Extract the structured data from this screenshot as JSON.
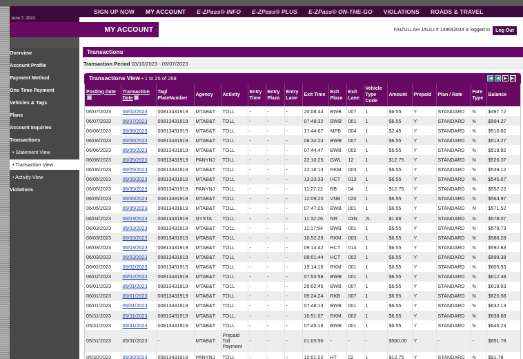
{
  "nav": {
    "items": [
      {
        "label": "SIGN UP NOW",
        "italic": false,
        "active": false
      },
      {
        "label": "MY ACCOUNT",
        "italic": false,
        "active": true
      },
      {
        "label": "E-ZPass® INFO",
        "italic": true,
        "active": false
      },
      {
        "label": "E-ZPass® PLUS",
        "italic": true,
        "active": false
      },
      {
        "label": "E-ZPass® ON-THE-GO",
        "italic": true,
        "active": false
      },
      {
        "label": "VIOLATIONS",
        "italic": false,
        "active": false
      },
      {
        "label": "ROADS & TRAVEL",
        "italic": false,
        "active": false
      }
    ]
  },
  "header": {
    "date": "June 7, 2023",
    "title": "MY ACCOUNT",
    "user_line": "FAIZULLAH JALILI # 148643034 is logged in",
    "logout_label": "Log Out"
  },
  "sidebar": {
    "items": [
      {
        "label": "Overview",
        "sub": false,
        "active": false
      },
      {
        "label": "Account Profile",
        "sub": false,
        "active": false
      },
      {
        "label": "Payment Method",
        "sub": false,
        "active": false
      },
      {
        "label": "One Time Payment",
        "sub": false,
        "active": false
      },
      {
        "label": "Vehicles & Tags",
        "sub": false,
        "active": false
      },
      {
        "label": "Plans",
        "sub": false,
        "active": false
      },
      {
        "label": "Account Inquiries",
        "sub": false,
        "active": false
      },
      {
        "label": "Transactions",
        "sub": false,
        "active": false
      },
      {
        "label": "• Statement View",
        "sub": true,
        "active": false
      },
      {
        "label": "• Transaction View",
        "sub": true,
        "active": true
      },
      {
        "label": "• Activity View",
        "sub": true,
        "active": false
      },
      {
        "label": "Violations",
        "sub": false,
        "active": false
      }
    ]
  },
  "section": {
    "title": "Transactions",
    "period_label": "Transaction Period",
    "period_value": "03/10/2023 - 06/07/2023"
  },
  "view": {
    "title": "Transactions View",
    "count": " • 1 to 25 of 268",
    "pager": [
      "|◀",
      "◀",
      "▶",
      "▶|"
    ]
  },
  "table": {
    "columns": [
      "Posting Date",
      "Transaction Date",
      "Tag/ PlateNumber",
      "Agency",
      "Activity",
      "Entry Time",
      "Entry Plaza",
      "Entry Lane",
      "Exit Time",
      "Exit Plaza",
      "Exit Lane",
      "Vehicle Type Code",
      "Amount",
      "Prepaid",
      "Plan / Rate",
      "Fare Type",
      "Balance"
    ],
    "rows": [
      [
        "06/07/2023",
        "06/02/2023",
        "00813431919",
        "MTAB&T",
        "TOLL",
        "-",
        "-",
        "-",
        "20:08:44",
        "BWB",
        "007",
        "1",
        "$6.55",
        "Y",
        "STANDARD",
        "N",
        "$497.72"
      ],
      [
        "06/07/2023",
        "06/07/2023",
        "00813431919",
        "MTAB&T",
        "TOLL",
        "-",
        "-",
        "-",
        "07:48:32",
        "BWB",
        "001",
        "1",
        "$6.55",
        "Y",
        "STANDARD",
        "N",
        "$504.27"
      ],
      [
        "06/06/2023",
        "06/06/2023",
        "00813431919",
        "MTAB&T",
        "TOLL",
        "-",
        "-",
        "-",
        "17:44:07",
        "MPB",
        "004",
        "1",
        "$2.45",
        "Y",
        "STANDARD",
        "N",
        "$510.82"
      ],
      [
        "06/06/2023",
        "06/06/2023",
        "00813431919",
        "MTAB&T",
        "TOLL",
        "-",
        "-",
        "-",
        "08:34:24",
        "BWB",
        "007",
        "1",
        "$6.55",
        "Y",
        "STANDARD",
        "N",
        "$513.27"
      ],
      [
        "06/06/2023",
        "06/06/2023",
        "00813431919",
        "MTAB&T",
        "TOLL",
        "-",
        "-",
        "-",
        "07:44:47",
        "BWB",
        "002",
        "1",
        "$6.55",
        "Y",
        "STANDARD",
        "N",
        "$519.82"
      ],
      [
        "06/06/2023",
        "06/05/2023",
        "00813431919",
        "PANYNJ",
        "TOLL",
        "-",
        "-",
        "-",
        "22:10:25",
        "GWL",
        "12",
        "1",
        "$12.75",
        "Y",
        "STANDARD",
        "N",
        "$526.37"
      ],
      [
        "06/06/2023",
        "06/05/2023",
        "00813431919",
        "MTAB&T",
        "TOLL",
        "-",
        "-",
        "-",
        "22:18:14",
        "RKM",
        "003",
        "1",
        "$6.55",
        "Y",
        "STANDARD",
        "N",
        "$539.12"
      ],
      [
        "06/05/2023",
        "06/05/2023",
        "00813431919",
        "MTAB&T",
        "TOLL",
        "-",
        "-",
        "-",
        "13:33:33",
        "HCT",
        "013",
        "1",
        "$6.55",
        "Y",
        "STANDARD",
        "N",
        "$545.67"
      ],
      [
        "06/05/2023",
        "06/05/2023",
        "00813431919",
        "PANYNJ",
        "TOLL",
        "-",
        "-",
        "-",
        "11:27:22",
        "BB",
        "04",
        "1",
        "$12.75",
        "Y",
        "STANDARD",
        "N",
        "$552.22"
      ],
      [
        "06/05/2023",
        "06/05/2023",
        "00813431919",
        "MTAB&T",
        "TOLL",
        "-",
        "-",
        "-",
        "12:09:20",
        "VNB",
        "020",
        "1",
        "$6.55",
        "Y",
        "STANDARD",
        "N",
        "$564.97"
      ],
      [
        "06/05/2023",
        "06/05/2023",
        "00813431919",
        "MTAB&T",
        "TOLL",
        "-",
        "-",
        "-",
        "07:47:25",
        "BWB",
        "001",
        "1",
        "$6.55",
        "Y",
        "STANDARD",
        "N",
        "$571.52"
      ],
      [
        "06/04/2023",
        "06/03/2023",
        "00813431919",
        "NYSTA",
        "TOLL",
        "-",
        "-",
        "-",
        "11:32:26",
        "NR",
        "03N",
        "2L",
        "$1.66",
        "Y",
        "STANDARD",
        "N",
        "$578.07"
      ],
      [
        "06/03/2023",
        "06/03/2023",
        "00813431919",
        "MTAB&T",
        "TOLL",
        "-",
        "-",
        "-",
        "11:17:54",
        "BWB",
        "001",
        "1",
        "$6.55",
        "Y",
        "STANDARD",
        "N",
        "$579.73"
      ],
      [
        "06/03/2023",
        "06/03/2023",
        "00813431919",
        "MTAB&T",
        "TOLL",
        "-",
        "-",
        "-",
        "10:52:29",
        "RKM",
        "003",
        "1",
        "$6.55",
        "Y",
        "STANDARD",
        "N",
        "$586.28"
      ],
      [
        "06/03/2023",
        "06/03/2023",
        "00813431919",
        "MTAB&T",
        "TOLL",
        "-",
        "-",
        "-",
        "09:14:42",
        "HCT",
        "014",
        "1",
        "$6.55",
        "Y",
        "STANDARD",
        "N",
        "$592.83"
      ],
      [
        "06/03/2023",
        "06/03/2023",
        "00813431919",
        "MTAB&T",
        "TOLL",
        "-",
        "-",
        "-",
        "08:01:44",
        "HCT",
        "002",
        "1",
        "$6.55",
        "Y",
        "STANDARD",
        "N",
        "$599.38"
      ],
      [
        "06/02/2023",
        "06/02/2023",
        "00813431919",
        "MTAB&T",
        "TOLL",
        "-",
        "-",
        "-",
        "19:14:16",
        "RKM",
        "001",
        "1",
        "$6.55",
        "Y",
        "STANDARD",
        "N",
        "$605.93"
      ],
      [
        "06/02/2023",
        "06/02/2023",
        "00813431919",
        "MTAB&T",
        "TOLL",
        "-",
        "-",
        "-",
        "07:53:58",
        "BWB",
        "001",
        "1",
        "$6.55",
        "Y",
        "STANDARD",
        "N",
        "$612.48"
      ],
      [
        "06/01/2023",
        "06/01/2023",
        "00813431919",
        "MTAB&T",
        "TOLL",
        "-",
        "-",
        "-",
        "20:02:45",
        "BWB",
        "007",
        "1",
        "$6.55",
        "Y",
        "STANDARD",
        "N",
        "$619.03"
      ],
      [
        "06/01/2023",
        "06/01/2023",
        "00813431919",
        "MTAB&T",
        "TOLL",
        "-",
        "-",
        "-",
        "09:24:24",
        "RKB",
        "007",
        "1",
        "$6.55",
        "Y",
        "STANDARD",
        "N",
        "$625.58"
      ],
      [
        "06/01/2023",
        "06/01/2023",
        "00813431919",
        "MTAB&T",
        "TOLL",
        "-",
        "-",
        "-",
        "07:48:13",
        "BWB",
        "001",
        "1",
        "$6.55",
        "Y",
        "STANDARD",
        "N",
        "$632.13"
      ],
      [
        "05/31/2023",
        "05/31/2023",
        "00813431919",
        "MTAB&T",
        "TOLL",
        "-",
        "-",
        "-",
        "10:51:07",
        "RKM",
        "002",
        "1",
        "$6.55",
        "Y",
        "STANDARD",
        "N",
        "$638.68"
      ],
      [
        "05/31/2023",
        "05/31/2023",
        "00813431919",
        "MTAB&T",
        "TOLL",
        "-",
        "-",
        "-",
        "07:45:18",
        "BWB",
        "001",
        "1",
        "$6.55",
        "Y",
        "STANDARD",
        "N",
        "$645.23"
      ],
      [
        "05/31/2023",
        "05/31/2023",
        "-",
        "MTAB&T",
        "Prepaid Toll Payment",
        "-",
        "-",
        "-",
        "01:05:50",
        "-",
        "-",
        "-",
        "$560.00",
        "Y",
        "-",
        "-",
        "$651.78"
      ],
      [
        "05/30/2023",
        "05/30/2023",
        "00813431919",
        "PANYNJ",
        "TOLL",
        "-",
        "-",
        "-",
        "12:01:22",
        "HT",
        "02",
        "1",
        "$12.75",
        "Y",
        "STANDARD",
        "N",
        "$91.78"
      ]
    ],
    "unlinked_txn_rows": [
      23
    ]
  }
}
